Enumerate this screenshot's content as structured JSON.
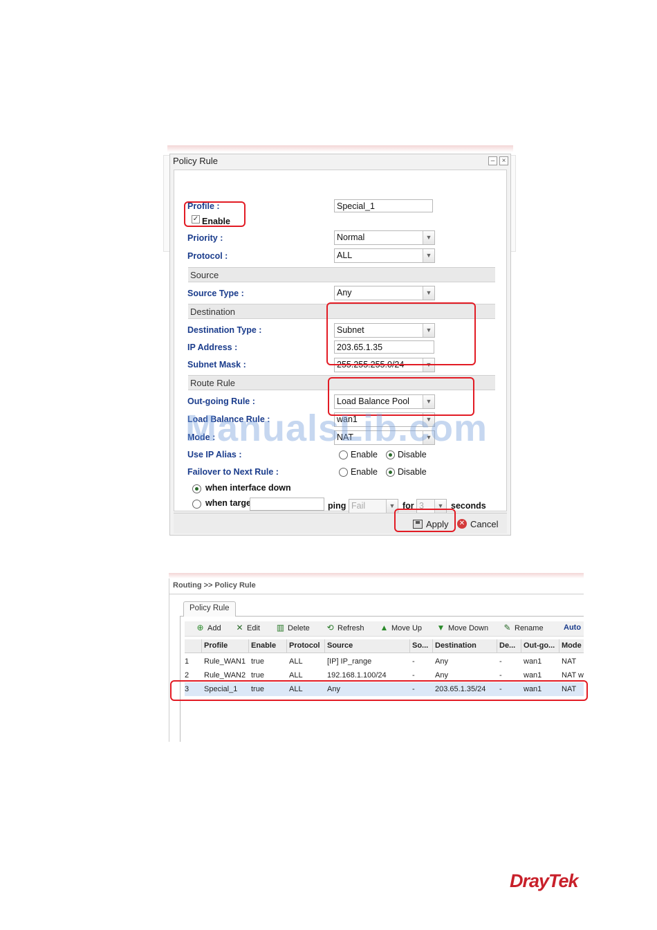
{
  "dialog": {
    "title": "Policy Rule",
    "minimize": "–",
    "close": "×",
    "profile_label": "Profile :",
    "profile_value": "Special_1",
    "enable_label": "Enable",
    "enable_checked": true,
    "priority_label": "Priority :",
    "priority_value": "Normal",
    "protocol_label": "Protocol :",
    "protocol_value": "ALL",
    "source_section": "Source",
    "source_type_label": "Source Type :",
    "source_type_value": "Any",
    "destination_section": "Destination",
    "dest_type_label": "Destination Type :",
    "dest_type_value": "Subnet",
    "ip_label": "IP Address :",
    "ip_value": "203.65.1.35",
    "mask_label": "Subnet Mask :",
    "mask_value": "255.255.255.0/24",
    "route_section": "Route Rule",
    "outgoing_label": "Out-going Rule :",
    "outgoing_value": "Load Balance Pool",
    "lb_label": "Load Balance Rule :",
    "lb_value": "wan1",
    "mode_label": "Mode :",
    "mode_value": "NAT",
    "alias_label": "Use IP Alias :",
    "failover_label": "Failover to Next Rule :",
    "enable_opt": "Enable",
    "disable_opt": "Disable",
    "when_iface_down": "when interface down",
    "when_target": "when target",
    "ping_label": "ping",
    "ping_value": "Fail",
    "for_label": "for",
    "for_value": "3",
    "seconds_label": "seconds",
    "apply": "Apply",
    "cancel": "Cancel"
  },
  "watermark": "ManualsLib.com",
  "table_page": {
    "breadcrumb": "Routing >> Policy Rule",
    "tab": "Policy Rule",
    "toolbar": {
      "add": "Add",
      "edit": "Edit",
      "delete": "Delete",
      "refresh": "Refresh",
      "move_up": "Move Up",
      "move_down": "Move Down",
      "rename": "Rename",
      "auto": "Auto"
    },
    "columns": [
      "Profile",
      "Enable",
      "Protocol",
      "Source",
      "So...",
      "Destination",
      "De...",
      "Out-go...",
      "Mode"
    ],
    "rows": [
      [
        "1",
        "Rule_WAN1",
        "true",
        "ALL",
        "[IP] IP_range",
        "-",
        "Any",
        "-",
        "wan1",
        "NAT"
      ],
      [
        "2",
        "Rule_WAN2",
        "true",
        "ALL",
        "192.168.1.100/24",
        "-",
        "Any",
        "-",
        "wan1",
        "NAT w"
      ],
      [
        "3",
        "Special_1",
        "true",
        "ALL",
        "Any",
        "-",
        "203.65.1.35/24",
        "-",
        "wan1",
        "NAT"
      ]
    ]
  },
  "brand": "DrayTek",
  "colors": {
    "highlight": "#e21b24",
    "label": "#1a3c8c",
    "brand": "#c8202a"
  }
}
